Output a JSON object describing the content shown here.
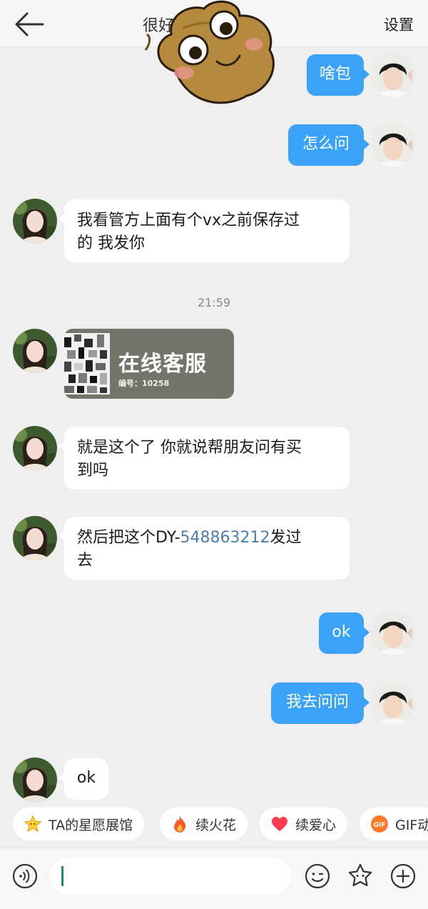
{
  "header": {
    "title": "很好",
    "settings_label": "设置"
  },
  "messages": [
    {
      "side": "out",
      "text": "啥包"
    },
    {
      "side": "out",
      "text": "怎么问"
    },
    {
      "side": "in",
      "text_line1": "我看管方上面有个vx之前保存过",
      "text_line2": "的 我发你"
    },
    {
      "time": "21:59"
    },
    {
      "side": "in",
      "type": "card",
      "card_title": "在线客服",
      "card_id": "编号：10258"
    },
    {
      "side": "in",
      "text_line1": "就是这个了 你就说帮朋友问有买",
      "text_line2": "到吗"
    },
    {
      "side": "in",
      "prefix": "然后把这个DY-",
      "link": "548863212",
      "suffix": "发过",
      "text_line2": "去"
    },
    {
      "side": "out",
      "text": "ok"
    },
    {
      "side": "out",
      "text": "我去问问"
    },
    {
      "side": "in",
      "text": "ok"
    }
  ],
  "chips": [
    {
      "label": "TA的星愿展馆",
      "icon": "star-icon"
    },
    {
      "label": "续火花",
      "icon": "fire-icon"
    },
    {
      "label": "续爱心",
      "icon": "heart-icon"
    },
    {
      "label": "GIF动",
      "icon": "gif-icon"
    }
  ],
  "colors": {
    "outgoing_bubble": "#3aa3f7",
    "link": "#4a7fad",
    "background": "#efefef"
  }
}
